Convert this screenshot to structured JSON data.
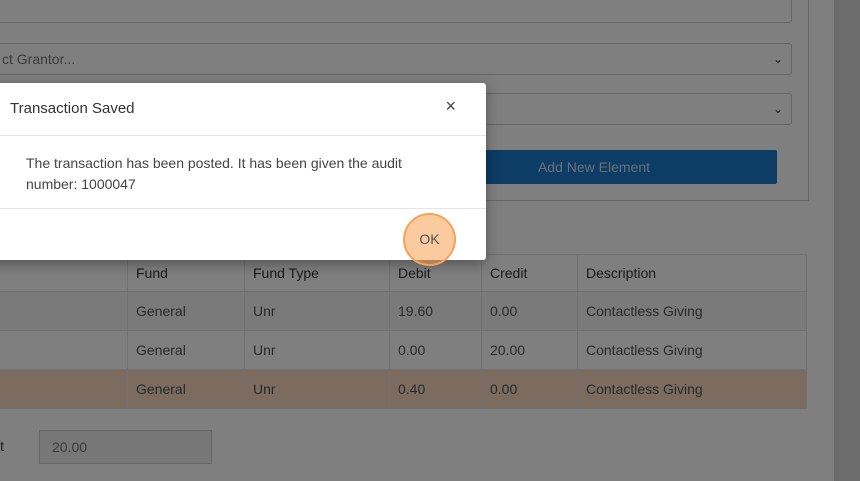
{
  "form": {
    "grantor_placeholder": "ct Grantor...",
    "second_select_value": "",
    "add_element_label": "Add New Element"
  },
  "table": {
    "headers": [
      "Fund",
      "Fund Type",
      "Debit",
      "Credit",
      "Description"
    ],
    "rows": [
      {
        "fund": "General",
        "fund_type": "Unr",
        "debit": "19.60",
        "credit": "0.00",
        "description": "Contactless Giving"
      },
      {
        "fund": "General",
        "fund_type": "Unr",
        "debit": "0.00",
        "credit": "20.00",
        "description": "Contactless Giving"
      },
      {
        "fund": "General",
        "fund_type": "Unr",
        "debit": "0.40",
        "credit": "0.00",
        "description": "Contactless Giving"
      }
    ]
  },
  "totals": {
    "credit_label": "it",
    "credit_value": "20.00"
  },
  "modal": {
    "title": "Transaction Saved",
    "close_symbol": "×",
    "message": "The transaction has been posted. It has been given the audit number: 1000047",
    "ok_label": "OK"
  },
  "colors": {
    "primary_button": "#1b78c8",
    "highlight_row": "#f6d9bf",
    "click_indicator": "#f4a35a"
  }
}
